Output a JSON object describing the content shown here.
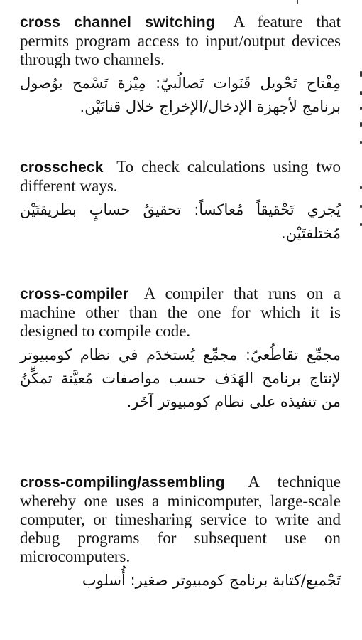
{
  "entries": [
    {
      "term": "cross channel switching",
      "definition": "A feature that permits program access to input/output devices through two channels.",
      "arabic": "مِفْتاح تَحْويل قَنَوات تَصالُبيّ: مِيْزة تَسْمح بوُصول برنامج لأجهزة الإدخال/الإخراج خلال قناتَيْن."
    },
    {
      "term": "crosscheck",
      "definition": "To check calculations using two different ways.",
      "arabic": "يُجري تَحْقيقاً مُعاكساً: تحقيقُ حسابٍ بطريقتَيْن مُختلفتَيْن."
    },
    {
      "term": "cross-compiler",
      "definition": "A compiler that runs on a machine other than the one for which it is designed to compile code.",
      "arabic": "مجمِّع تقاطُعيّ: مجمِّع يُستخدَم في نظام كومبيوتر لإنتاج برنامج الهَدَف حسب مواصفات مُعيَّنة تمكِّنُ من تنفيذه على نظام كومبيوتر آخَر."
    },
    {
      "term": "cross-compiling/assembling",
      "definition": "A technique whereby one uses a minicomputer, large-scale computer, or timesharing service to write and debug programs for subsequent use on microcomputers.",
      "arabic": "تَجْميع/كتابة برنامج كومبيوتر صغير: أُسلوب"
    }
  ]
}
